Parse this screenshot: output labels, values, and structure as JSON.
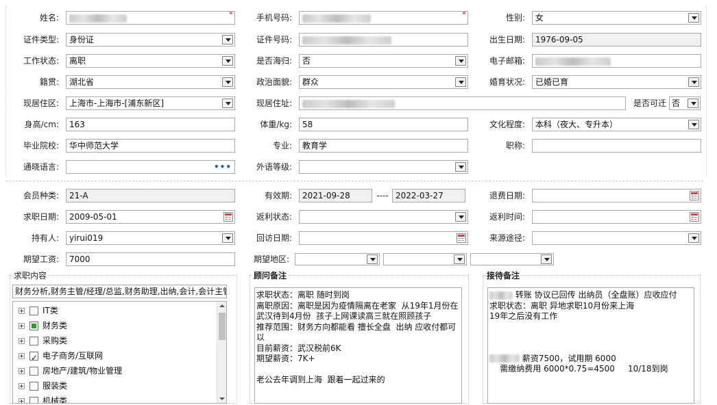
{
  "personal": {
    "name_label": "姓名:",
    "phone_label": "手机号码:",
    "required_mark": "*",
    "gender_label": "性别:",
    "gender_value": "女",
    "id_type_label": "证件类型:",
    "id_type_value": "身份证",
    "id_number_label": "证件号码:",
    "birth_label": "出生日期:",
    "birth_value": "1976-09-05",
    "work_status_label": "工作状态:",
    "work_status_value": "离职",
    "returnee_label": "是否海归:",
    "returnee_value": "否",
    "email_label": "电子邮箱:",
    "native_label": "籍贯:",
    "native_value": "湖北省",
    "political_label": "政治面貌:",
    "political_value": "群众",
    "marital_label": "婚育状况:",
    "marital_value": "已婚已育",
    "residence_area_label": "现居住区:",
    "residence_area_value": "上海市-上海市-[浦东新区]",
    "residence_addr_label": "现居住址:",
    "relocate_label": "是否可迁",
    "relocate_value": "否",
    "height_label": "身高/cm:",
    "height_value": "163",
    "weight_label": "体重/kg:",
    "weight_value": "58",
    "education_label": "文化程度:",
    "education_value": "本科（夜大、专升本）",
    "school_label": "毕业院校:",
    "school_value": "华中师范大学",
    "major_label": "专业:",
    "major_value": "教育学",
    "title_label": "职称:",
    "language_label": "通晓语言:",
    "language_dots": "•••",
    "foreign_level_label": "外语等级:"
  },
  "membership": {
    "member_type_label": "会员种类:",
    "member_type_value": "21-A",
    "valid_label": "有效期:",
    "valid_from": "2021-09-28",
    "valid_sep": "----",
    "valid_to": "2022-03-27",
    "refund_date_label": "退费日期:",
    "job_date_label": "求职日期:",
    "job_date_value": "2009-05-01",
    "rebate_status_label": "返利状态:",
    "rebate_time_label": "返利时间:",
    "holder_label": "持有人:",
    "holder_value": "yirui019",
    "visit_date_label": "回访日期:",
    "source_label": "来源途径:",
    "salary_label": "期望工资:",
    "salary_value": "7000",
    "region_label": "期望地区:"
  },
  "job_content": {
    "title": "求职内容",
    "summary": "财务分析,财务主管/经理/总监,财务助理,出纳,会计,会计主管",
    "tree": [
      {
        "label": "IT类",
        "state": "none"
      },
      {
        "label": "财务类",
        "state": "partial"
      },
      {
        "label": "采购类",
        "state": "none"
      },
      {
        "label": "电子商务/互联网",
        "state": "checked"
      },
      {
        "label": "房地产/建筑/物业管理",
        "state": "none"
      },
      {
        "label": "服装类",
        "state": "none"
      },
      {
        "label": "机械类",
        "state": "none"
      }
    ]
  },
  "advisor_notes": {
    "title": "顾问备注",
    "text": "求职状态：离职 随时到岗\n离职原因：离职是因为疫情隔离在老家  从19年1月份在武汉待到4月份  孩子上网课读高三就在照顾孩子\n推荐范围：财务方向都能看 擅长全盘  出纳 应收付都可以\n目前薪资：武汉税前6K\n期望薪资：7K+\n\n老公去年调到上海  跟着一起过来的"
  },
  "reception_notes": {
    "title": "接待备注",
    "line1": "  转账   协议已回传  出纳员（全盘账）应收应付",
    "line2": "求职状态：离职 异地求职10月份来上海",
    "line3": "19年之后没有工作",
    "line4": "   薪资7500，试用期 6000",
    "line5": "    需缴纳费用 6000*0.75=4500     10/18到岗"
  }
}
